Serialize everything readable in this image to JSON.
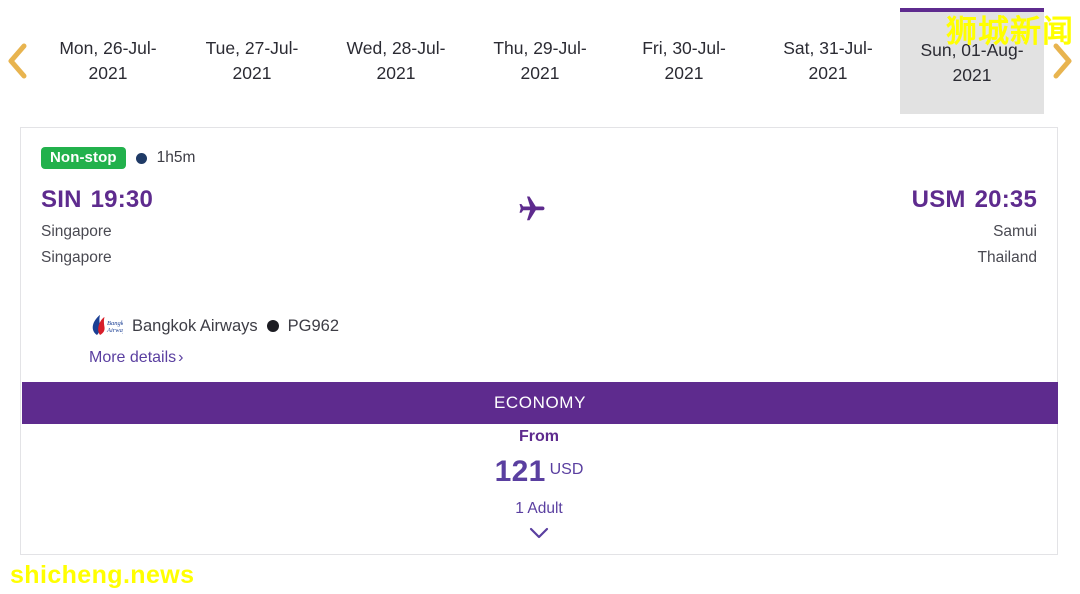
{
  "date_strip": {
    "prev_label": "previous-dates",
    "next_label": "next-dates",
    "dates": [
      {
        "line1": "Mon, 26-Jul-",
        "line2": "2021",
        "full": "Mon, 26-Jul-2021",
        "selected": false
      },
      {
        "line1": "Tue, 27-Jul-",
        "line2": "2021",
        "full": "Tue, 27-Jul-2021",
        "selected": false
      },
      {
        "line1": "Wed, 28-Jul-",
        "line2": "2021",
        "full": "Wed, 28-Jul-2021",
        "selected": false
      },
      {
        "line1": "Thu, 29-Jul-",
        "line2": "2021",
        "full": "Thu, 29-Jul-2021",
        "selected": false
      },
      {
        "line1": "Fri, 30-Jul-2021",
        "line2": "",
        "full": "Fri, 30-Jul-2021",
        "selected": false
      },
      {
        "line1": "Sat, 31-Jul-",
        "line2": "2021",
        "full": "Sat, 31-Jul-2021",
        "selected": false
      },
      {
        "line1": "Sun, 01-Aug-",
        "line2": "2021",
        "full": "Sun, 01-Aug-2021",
        "selected": true
      }
    ]
  },
  "flight": {
    "stops_badge": "Non-stop",
    "duration": "1h5m",
    "depart": {
      "code": "SIN",
      "time": "19:30",
      "city": "Singapore",
      "country": "Singapore"
    },
    "arrive": {
      "code": "USM",
      "time": "20:35",
      "city": "Samui",
      "country": "Thailand"
    },
    "airline_name": "Bangkok Airways",
    "flight_number": "PG962",
    "more_details": "More details",
    "more_details_chevron": "›"
  },
  "fare": {
    "cabin": "ECONOMY",
    "from_label": "From",
    "amount": "121",
    "currency": "USD",
    "passengers": "1 Adult"
  },
  "watermarks": {
    "chinese": "狮城新闻",
    "english": "shicheng.news"
  },
  "colors": {
    "brand_purple": "#5e2b8e",
    "link_purple": "#5a3fa0",
    "nonstop_green": "#22b14c",
    "arrow_gold": "#e8b44f",
    "watermark_yellow": "#ffff00"
  }
}
